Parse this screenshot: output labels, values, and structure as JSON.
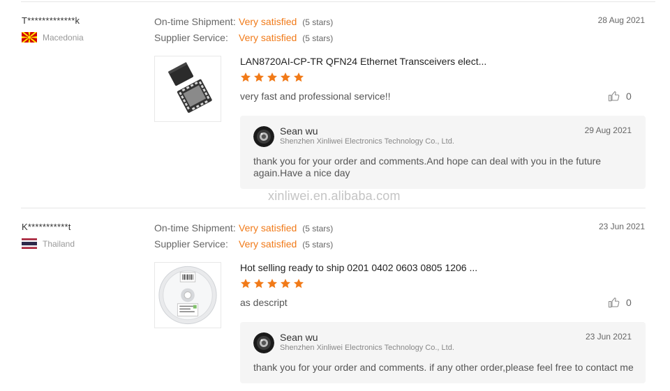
{
  "watermark": "xinliwei.en.alibaba.com",
  "colors": {
    "accent": "#f17a18",
    "reply_bg": "#f5f5f5"
  },
  "reviews": [
    {
      "buyer": "T*************k",
      "country": "Macedonia",
      "flag": "macedonia-flag-icon",
      "date": "28 Aug 2021",
      "ratings": [
        {
          "label": "On-time Shipment:",
          "value": "Very satisfied",
          "stars": "(5 stars)"
        },
        {
          "label": "Supplier Service:",
          "value": "Very satisfied",
          "stars": "(5 stars)"
        }
      ],
      "product_title": "LAN8720AI-CP-TR QFN24 Ethernet Transceivers elect...",
      "product_image": "qfn-chip-image",
      "star_count": 5,
      "comment": "very fast and professional service!!",
      "likes": "0",
      "reply": {
        "name": "Sean wu",
        "company": "Shenzhen Xinliwei Electronics Technology Co., Ltd.",
        "date": "29 Aug 2021",
        "text": "thank you for your order and comments.And hope can deal with you in  the future again.Have a nice day"
      }
    },
    {
      "buyer": "K***********t",
      "country": "Thailand",
      "flag": "thailand-flag-icon",
      "date": "23 Jun 2021",
      "ratings": [
        {
          "label": "On-time Shipment:",
          "value": "Very satisfied",
          "stars": "(5 stars)"
        },
        {
          "label": "Supplier Service:",
          "value": "Very satisfied",
          "stars": "(5 stars)"
        }
      ],
      "product_title": "Hot selling ready to ship 0201 0402 0603 0805 1206 ...",
      "product_image": "component-reel-image",
      "star_count": 5,
      "comment": "as descript",
      "likes": "0",
      "reply": {
        "name": "Sean wu",
        "company": "Shenzhen Xinliwei Electronics Technology Co., Ltd.",
        "date": "23 Jun 2021",
        "text": "thank you for your order and comments. if any other order,please feel free to contact me"
      }
    }
  ]
}
